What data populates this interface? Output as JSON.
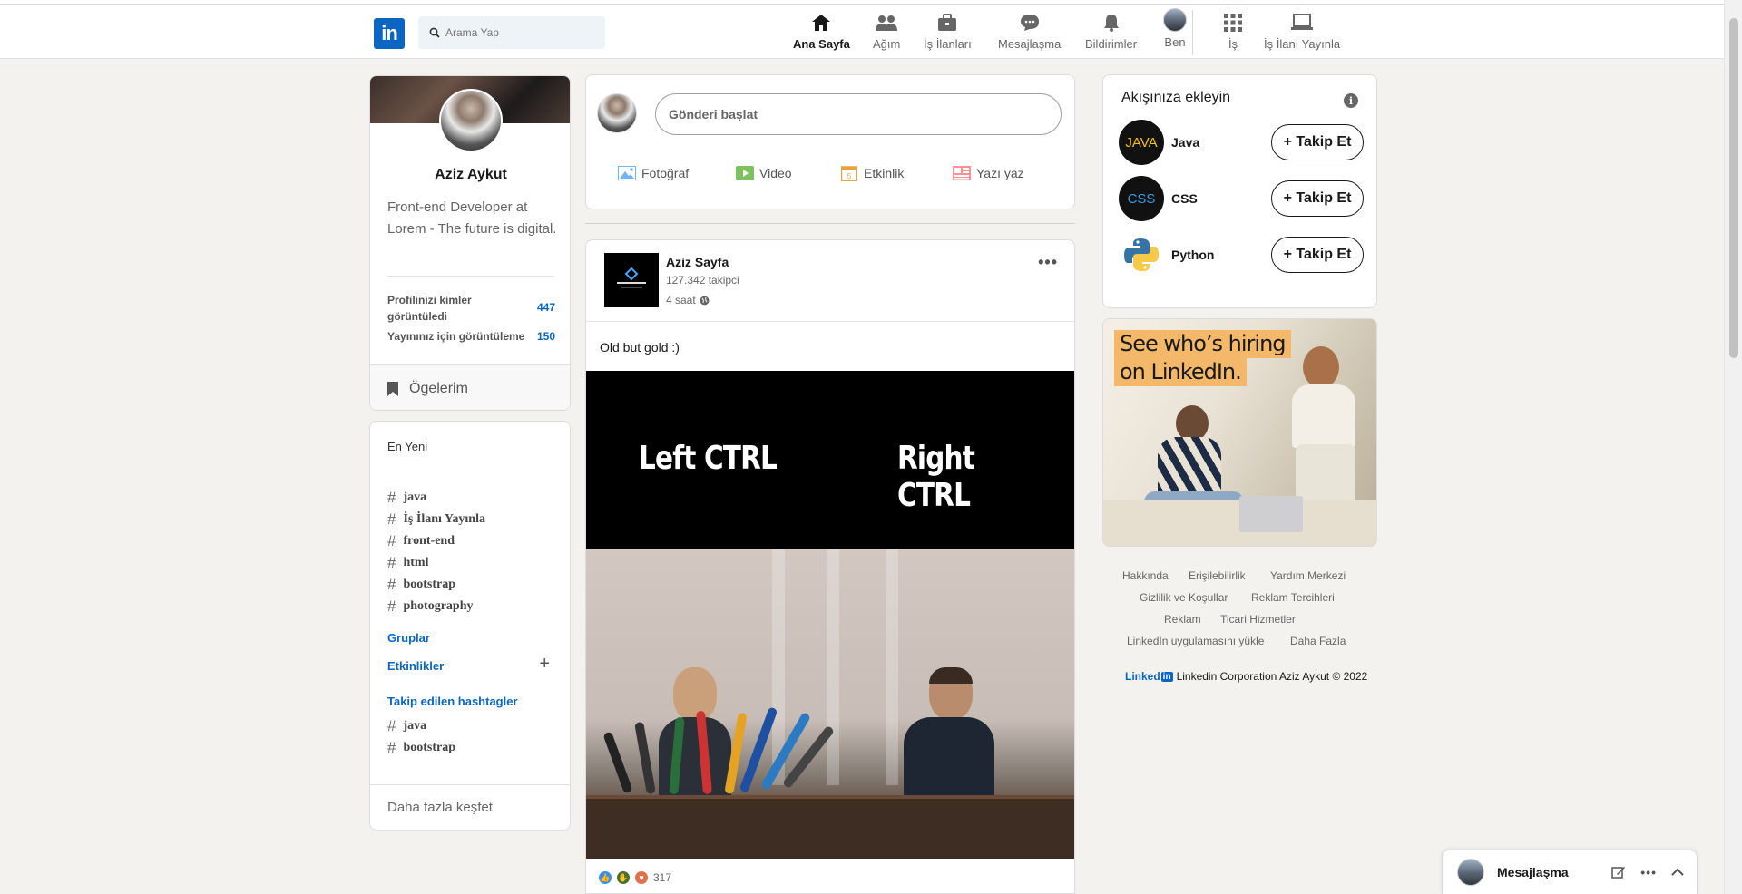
{
  "search": {
    "placeholder": "Arama Yap"
  },
  "nav": {
    "home": "Ana Sayfa",
    "network": "Ağım",
    "jobs": "İş İlanları",
    "messaging": "Mesajlaşma",
    "notifications": "Bildirimler",
    "me": "Ben",
    "work": "İş",
    "post_job": "İş İlanı Yayınla"
  },
  "profile": {
    "name": "Aziz Aykut",
    "headline": "Front-end Developer at Lorem - The future is digital.",
    "stats": [
      {
        "label": "Profilinizi kimler görüntüledi",
        "value": "447"
      },
      {
        "label": "Yayınınız için görüntüleme",
        "value": "150"
      }
    ],
    "items_label": "Ögelerim"
  },
  "discover": {
    "recent_title": "En Yeni",
    "recent_tags": [
      "java",
      "İş İlanı Yayınla",
      "front-end",
      "html",
      "bootstrap",
      "photography"
    ],
    "groups": "Gruplar",
    "events": "Etkinlikler",
    "followed_title": "Takip edilen hashtagler",
    "followed_tags": [
      "java",
      "bootstrap"
    ],
    "more": "Daha fazla keşfet"
  },
  "share": {
    "placeholder": "Gönderi başlat",
    "actions": [
      "Fotoğraf",
      "Video",
      "Etkinlik",
      "Yazı yaz"
    ]
  },
  "post": {
    "author": "Aziz Sayfa",
    "followers": "127.342 takipci",
    "time": "4 saat",
    "text": "Old but gold :)",
    "meme_left": "Left CTRL",
    "meme_right": "Right CTRL",
    "reaction_count": "317"
  },
  "follow": {
    "title": "Akışınıza ekleyin",
    "button_label": "+ Takip Et",
    "items": [
      {
        "name": "Java",
        "logo_text": "JAVA"
      },
      {
        "name": "CSS",
        "logo_text": "CSS"
      },
      {
        "name": "Python",
        "logo_text": ""
      }
    ]
  },
  "ad": {
    "line1": "See who’s hiring",
    "line2": "on LinkedIn."
  },
  "footer": {
    "links": [
      "Hakkında",
      "Erişilebilirlik",
      "Yardım Merkezi",
      "Gizlilik ve Koşullar",
      "Reklam Tercihleri",
      "Reklam",
      "Ticari Hizmetler",
      "LinkedIn uygulamasını yükle",
      "Daha Fazla"
    ],
    "brand": "Linked",
    "brand_box": "in",
    "copyright": "Linkedin Corporation Aziz Aykut © 2022"
  },
  "messaging_bar": {
    "label": "Mesajlaşma"
  },
  "colors": {
    "accent": "#0a66c2",
    "background": "#f3f2ef"
  }
}
